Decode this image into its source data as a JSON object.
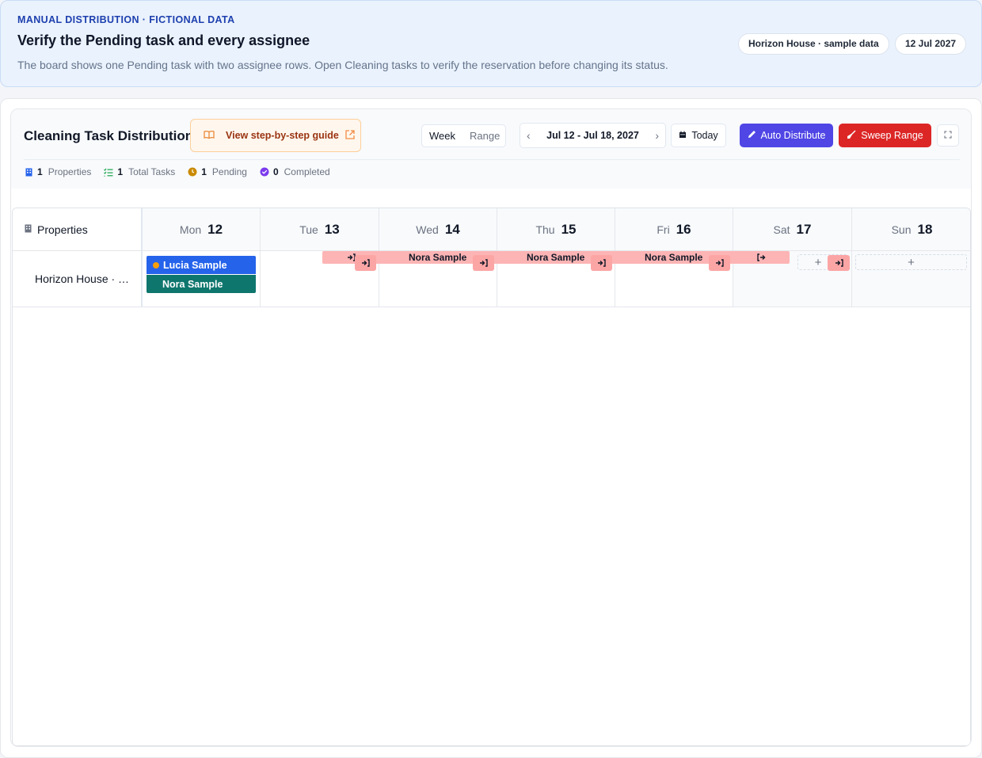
{
  "banner": {
    "eyebrow": "MANUAL DISTRIBUTION · FICTIONAL DATA",
    "title": "Verify the Pending task and every assignee",
    "description": "The board shows one Pending task with two assignee rows. Open Cleaning tasks to verify the reservation before changing its status.",
    "property_pill": "Horizon House · sample data",
    "date_pill": "12 Jul 2027"
  },
  "header": {
    "title": "Cleaning Task Distribution",
    "guide_label": "View step-by-step guide",
    "view_week": "Week",
    "view_range": "Range",
    "date_range": "Jul 12 - Jul 18, 2027",
    "today_label": "Today",
    "auto_label": "Auto Distribute",
    "sweep_label": "Sweep Range"
  },
  "stats": {
    "properties_count": "1",
    "properties_label": "Properties",
    "tasks_count": "1",
    "tasks_label": "Total Tasks",
    "pending_count": "1",
    "pending_label": "Pending",
    "completed_count": "0",
    "completed_label": "Completed"
  },
  "grid": {
    "properties_header": "Properties",
    "days": [
      {
        "name": "Mon",
        "num": "12"
      },
      {
        "name": "Tue",
        "num": "13"
      },
      {
        "name": "Wed",
        "num": "14"
      },
      {
        "name": "Thu",
        "num": "15"
      },
      {
        "name": "Fri",
        "num": "16"
      },
      {
        "name": "Sat",
        "num": "17"
      },
      {
        "name": "Sun",
        "num": "18"
      }
    ],
    "row_property": "Horizon House · …",
    "task_assignee_1": "Lucia Sample",
    "task_assignee_2": "Nora Sample",
    "reservation_guests": [
      "Nora Sample",
      "Nora Sample",
      "Nora Sample"
    ]
  },
  "colors": {
    "primary": "#4f46e5",
    "danger": "#dc2626",
    "task_blue": "#2563eb",
    "task_teal": "#0f766e",
    "reservation": "#fdb4b4",
    "pending": "#f59e0b"
  }
}
